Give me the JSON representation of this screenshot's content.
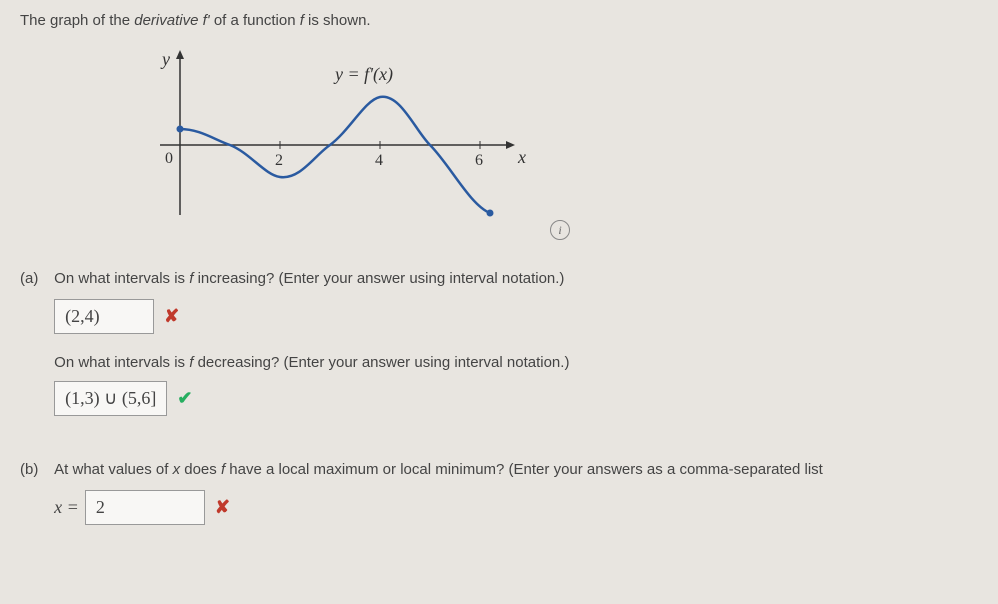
{
  "header": {
    "prefix": "The graph of the ",
    "italic1": "derivative f'",
    "mid": " of a function ",
    "italic2": "f",
    "suffix": " is shown."
  },
  "graph": {
    "ylabel": "y",
    "xlabel": "x",
    "curve_label": "y = f'(x)",
    "origin": "0",
    "ticks": [
      "2",
      "4",
      "6"
    ]
  },
  "info_icon_glyph": "i",
  "partA": {
    "label": "(a)",
    "q1_prefix": "On what intervals is ",
    "q1_italic": "f",
    "q1_suffix": " increasing? (Enter your answer using interval notation.)",
    "a1_value": "(2,4)",
    "a1_mark": "✘",
    "q2_prefix": "On what intervals is ",
    "q2_italic": "f",
    "q2_suffix": " decreasing? (Enter your answer using interval notation.)",
    "a2_value": "(1,3) ∪ (5,6]",
    "a2_mark": "✔"
  },
  "partB": {
    "label": "(b)",
    "q_prefix": "At what values of ",
    "q_x": "x",
    "q_mid": " does ",
    "q_f": "f",
    "q_suffix": " have a local maximum or local minimum? (Enter your answers as a comma-separated list",
    "eq_prefix": "x =",
    "b_value": "2",
    "b_mark": "✘"
  },
  "chart_data": {
    "type": "line",
    "title": "y = f'(x)",
    "xlabel": "x",
    "ylabel": "y",
    "xlim": [
      0,
      6.5
    ],
    "ylim": [
      -2,
      2
    ],
    "ticks_x": [
      0,
      2,
      4,
      6
    ],
    "series": [
      {
        "name": "f'(x)",
        "x": [
          0,
          0.5,
          1,
          1.5,
          2,
          2.5,
          3,
          3.5,
          4,
          4.5,
          5,
          5.5,
          6,
          6.2
        ],
        "values": [
          0.4,
          0.3,
          0.0,
          -0.6,
          -0.8,
          -0.6,
          0.0,
          0.9,
          1.2,
          0.9,
          0.0,
          -1.0,
          -1.7,
          -1.7
        ]
      }
    ],
    "zero_crossings_x": [
      1,
      3,
      5
    ],
    "endpoints": [
      {
        "x": 0,
        "y": 0.4,
        "closed": true
      },
      {
        "x": 6.2,
        "y": -1.7,
        "closed": true
      }
    ]
  }
}
